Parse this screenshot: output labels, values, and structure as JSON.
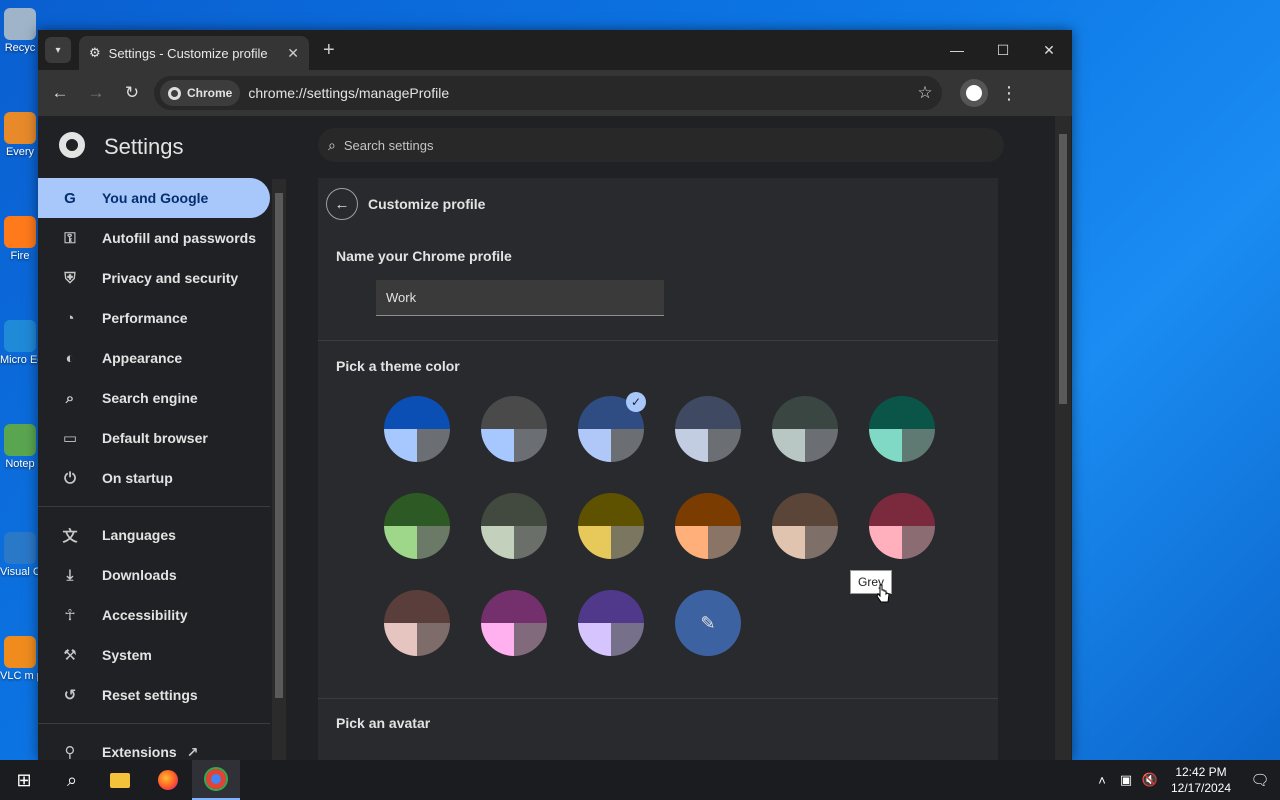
{
  "desktop": {
    "icons": [
      {
        "label": "Recyc",
        "color": "#9fb4c8"
      },
      {
        "label": "Every",
        "color": "#e88a2a"
      },
      {
        "label": "Fire",
        "color": "#ff7a1a"
      },
      {
        "label": "Micro Ed",
        "color": "#1f8ad8"
      },
      {
        "label": "Notep",
        "color": "#5aa650"
      },
      {
        "label": "Visual Co",
        "color": "#2a78c8"
      },
      {
        "label": "VLC m pla",
        "color": "#f08c1e"
      }
    ]
  },
  "browser": {
    "tab": {
      "title": "Settings - Customize profile",
      "icon": "gear-icon",
      "close": "✕"
    },
    "new_tab": "+",
    "window_controls": {
      "minimize": "—",
      "maximize": "☐",
      "close": "✕"
    },
    "omnibox": {
      "chip_label": "Chrome",
      "url": "chrome://settings/manageProfile"
    }
  },
  "settings": {
    "title": "Settings",
    "search_placeholder": "Search settings",
    "nav": [
      {
        "label": "You and Google",
        "icon": "G",
        "active": true
      },
      {
        "label": "Autofill and passwords",
        "icon": "⚿"
      },
      {
        "label": "Privacy and security",
        "icon": "⛨"
      },
      {
        "label": "Performance",
        "icon": "◔"
      },
      {
        "label": "Appearance",
        "icon": "◐"
      },
      {
        "label": "Search engine",
        "icon": "⌕"
      },
      {
        "label": "Default browser",
        "icon": "▭"
      },
      {
        "label": "On startup",
        "icon": "⏻"
      }
    ],
    "nav2": [
      {
        "label": "Languages",
        "icon": "文"
      },
      {
        "label": "Downloads",
        "icon": "⤓"
      },
      {
        "label": "Accessibility",
        "icon": "☥"
      },
      {
        "label": "System",
        "icon": "⚒"
      },
      {
        "label": "Reset settings",
        "icon": "↺"
      }
    ],
    "nav3": [
      {
        "label": "Extensions",
        "icon": "⚲",
        "trailing": "↗"
      }
    ],
    "page": {
      "title": "Customize profile",
      "name_label": "Name your Chrome profile",
      "name_value": "Work",
      "theme_label": "Pick a theme color",
      "avatar_label": "Pick an avatar",
      "tooltip": "Grey",
      "swatches": [
        {
          "top": "#0b4fb5",
          "bl": "#a6c8ff",
          "br": "#6b6f73"
        },
        {
          "top": "#4a4a4a",
          "bl": "#a6c8ff",
          "br": "#6b6f73"
        },
        {
          "top": "#2f4d82",
          "bl": "#b0c8f8",
          "br": "#6b6f73",
          "selected": true
        },
        {
          "top": "#3f4a62",
          "bl": "#c3cde2",
          "br": "#6b6f73"
        },
        {
          "top": "#3a4642",
          "bl": "#b8c7c3",
          "br": "#6b6f73"
        },
        {
          "top": "#0b5548",
          "bl": "#7fd9c5",
          "br": "#5f7a73"
        },
        {
          "top": "#2d5a24",
          "bl": "#9ed68a",
          "br": "#6b7a66"
        },
        {
          "top": "#424a40",
          "bl": "#c3d0bc",
          "br": "#6b6f6a"
        },
        {
          "top": "#5e5200",
          "bl": "#e6c95a",
          "br": "#7b7660"
        },
        {
          "top": "#7a3c00",
          "bl": "#ffb07a",
          "br": "#8a7466"
        },
        {
          "top": "#5a4538",
          "bl": "#e0c4b0",
          "br": "#7e7068"
        },
        {
          "top": "#7a2a3c",
          "bl": "#ffb0bc",
          "br": "#8a6c72"
        },
        {
          "top": "#5a3e3c",
          "bl": "#e6c4c0",
          "br": "#7e6c6a"
        },
        {
          "top": "#74306c",
          "bl": "#ffb0ee",
          "br": "#806a7c"
        },
        {
          "top": "#50388a",
          "bl": "#d6c4ff",
          "br": "#76708a"
        }
      ]
    }
  },
  "taskbar": {
    "time": "12:42 PM",
    "date": "12/17/2024"
  }
}
